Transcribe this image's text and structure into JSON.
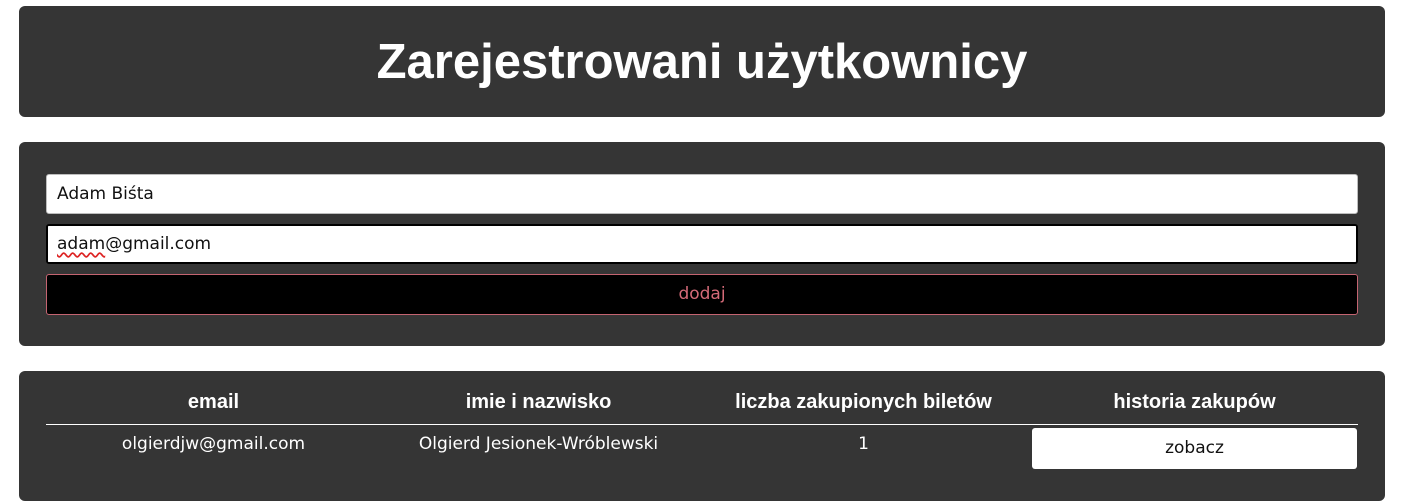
{
  "header": {
    "title": "Zarejestrowani użytkownicy"
  },
  "form": {
    "name_value": "Adam Biśta",
    "email_value_misspelled": "adam",
    "email_value_rest": "@gmail.com",
    "add_label": "dodaj"
  },
  "table": {
    "columns": [
      "email",
      "imie i nazwisko",
      "liczba zakupionych biletów",
      "historia zakupów"
    ],
    "rows": [
      {
        "email": "olgierdjw@gmail.com",
        "name": "Olgierd Jesionek-Wróblewski",
        "tickets": "1",
        "history_label": "zobacz"
      }
    ]
  },
  "colors": {
    "panel": "#353535",
    "button_bg": "#000000",
    "button_text": "#d46a78",
    "text": "#ffffff"
  }
}
